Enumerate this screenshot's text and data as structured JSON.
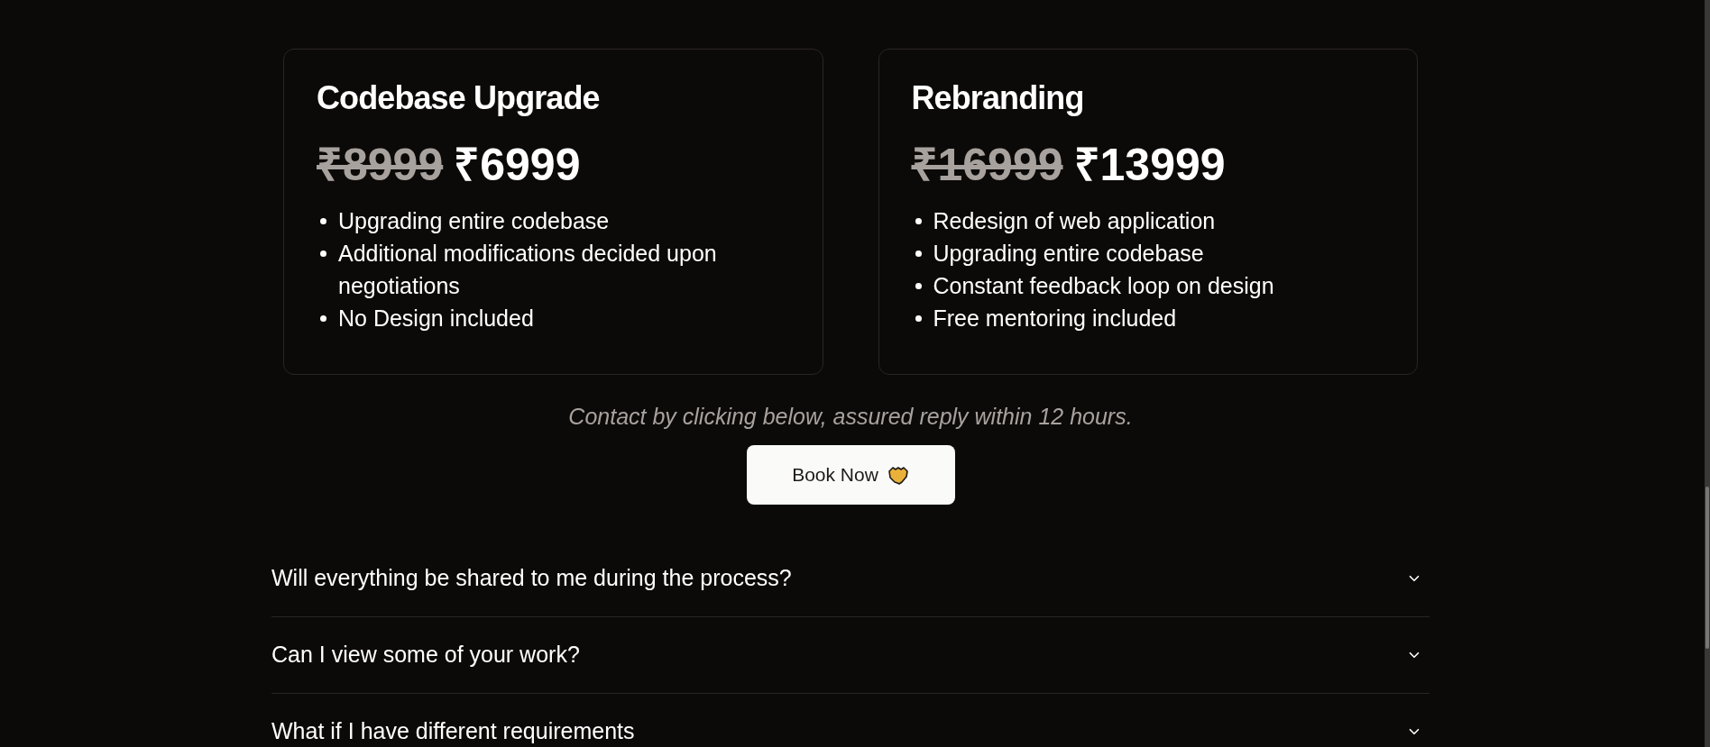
{
  "plans": [
    {
      "title": "Codebase Upgrade",
      "old_price": "₹8999",
      "price": "₹6999",
      "features": [
        "Upgrading entire codebase",
        "Additional modifications decided upon negotiations",
        "No Design included"
      ]
    },
    {
      "title": "Rebranding",
      "old_price": "₹16999",
      "price": "₹13999",
      "features": [
        "Redesign of web application",
        "Upgrading entire codebase",
        "Constant feedback loop on design",
        "Free mentoring included"
      ]
    }
  ],
  "contact_note": "Contact by clicking below, assured reply within 12 hours.",
  "book_button": {
    "label": "Book Now"
  },
  "faq": [
    {
      "question": "Will everything be shared to me during the process?",
      "expanded": false
    },
    {
      "question": "Can I view some of your work?",
      "expanded": false
    },
    {
      "question": "What if I have different requirements",
      "expanded": false
    }
  ]
}
